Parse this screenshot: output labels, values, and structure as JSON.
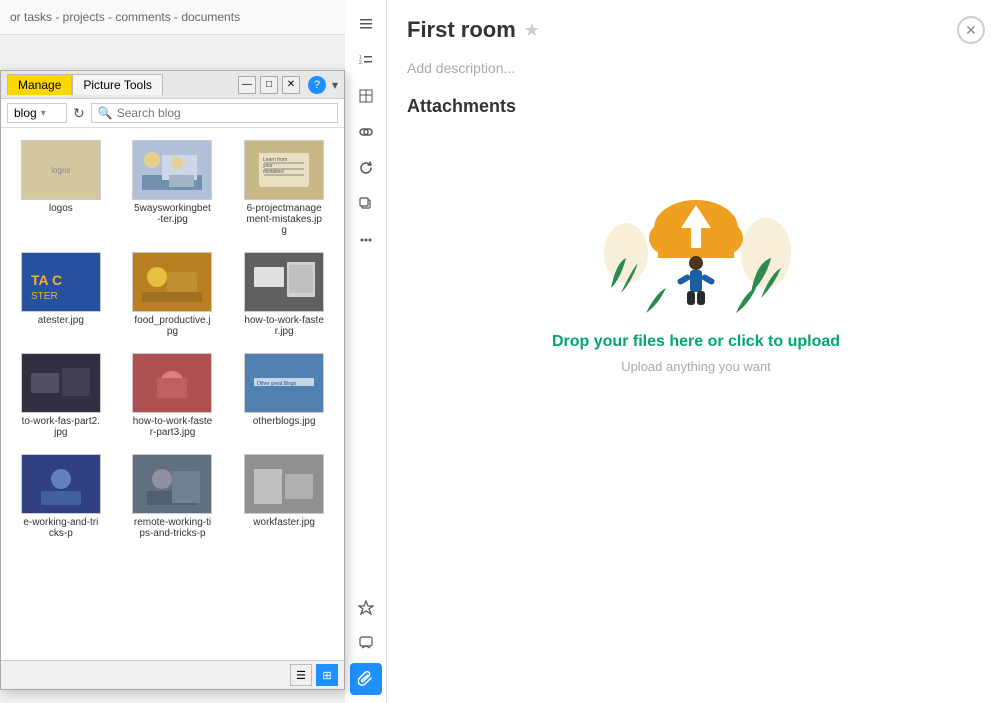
{
  "background_nav": {
    "text": "or tasks - projects - comments - documents"
  },
  "file_manager": {
    "title_tab_manage": "Manage",
    "title_tab_picture": "Picture Tools",
    "win_controls": [
      "—",
      "□",
      "✕"
    ],
    "location_value": "blog",
    "refresh_tooltip": "Refresh",
    "search_placeholder": "Search blog",
    "search_label": "Search blog",
    "help_label": "?",
    "dropdown_arrow": "▾",
    "files": [
      {
        "name": "logos",
        "thumb_color": "#e0d8c0",
        "label": "logos"
      },
      {
        "name": "5waysworkingbetter.jpg",
        "thumb_color": "#c8d4e8",
        "label": "5waysworkingbetter.jpg"
      },
      {
        "name": "6-projectmanagement-mistakes.jpg",
        "thumb_color": "#d4c8a8",
        "label": "6-projectmanagement-mistakes.jpg"
      },
      {
        "name": "atester.jpg",
        "thumb_color": "#3060b0",
        "label": "atester.jpg"
      },
      {
        "name": "food_productive.jpg",
        "thumb_color": "#c8a840",
        "label": "food_productive.jpg"
      },
      {
        "name": "how-to-work-faster.jpg",
        "thumb_color": "#808080",
        "label": "how-to-work-faster.jpg"
      },
      {
        "name": "to-work-fas-part2.jpg",
        "thumb_color": "#404050",
        "label": "to-work-fas-part2.jpg"
      },
      {
        "name": "how-to-work-fas-ter-part3.jpg",
        "thumb_color": "#c06060",
        "label": "how-to-work-fas-ter-part3.jpg"
      },
      {
        "name": "otherblogs.jpg",
        "thumb_color": "#6090c0",
        "label": "otherblogs.jpg"
      },
      {
        "name": "e-working-and-tricks-p",
        "thumb_color": "#4060a0",
        "label": "e-working-and-tricks-p"
      },
      {
        "name": "remote-working-tips-and-tricks-p",
        "thumb_color": "#708090",
        "label": "remote-working-tips-and-tricks-p"
      },
      {
        "name": "workfaster.jpg",
        "thumb_color": "#909090",
        "label": "workfaster.jpg"
      }
    ],
    "view_list_label": "List view",
    "view_grid_label": "Grid view"
  },
  "vertical_toolbar": {
    "buttons": [
      {
        "icon": "☰",
        "name": "list-icon",
        "tooltip": "List"
      },
      {
        "icon": "≡",
        "name": "ordered-list-icon",
        "tooltip": "Ordered list"
      },
      {
        "icon": "▤",
        "name": "table-icon",
        "tooltip": "Table"
      },
      {
        "icon": "🔗",
        "name": "link-icon",
        "tooltip": "Link"
      },
      {
        "icon": "↻",
        "name": "refresh-icon",
        "tooltip": "Refresh"
      },
      {
        "icon": "⧉",
        "name": "copy-icon",
        "tooltip": "Copy"
      },
      {
        "icon": "⋯",
        "name": "more-icon",
        "tooltip": "More"
      },
      {
        "icon": "⚡",
        "name": "quick-icon",
        "tooltip": "Quick"
      },
      {
        "icon": "💬",
        "name": "comment-icon",
        "tooltip": "Comment"
      },
      {
        "icon": "📎",
        "name": "attachment-icon",
        "tooltip": "Attachments",
        "active": true
      }
    ]
  },
  "main": {
    "room_title": "First room",
    "star_label": "★",
    "close_label": "✕",
    "add_description": "Add description...",
    "attachments_section": "Attachments",
    "drop_text": "Drop your files here or click to upload",
    "drop_subtext": "Upload anything you want"
  }
}
